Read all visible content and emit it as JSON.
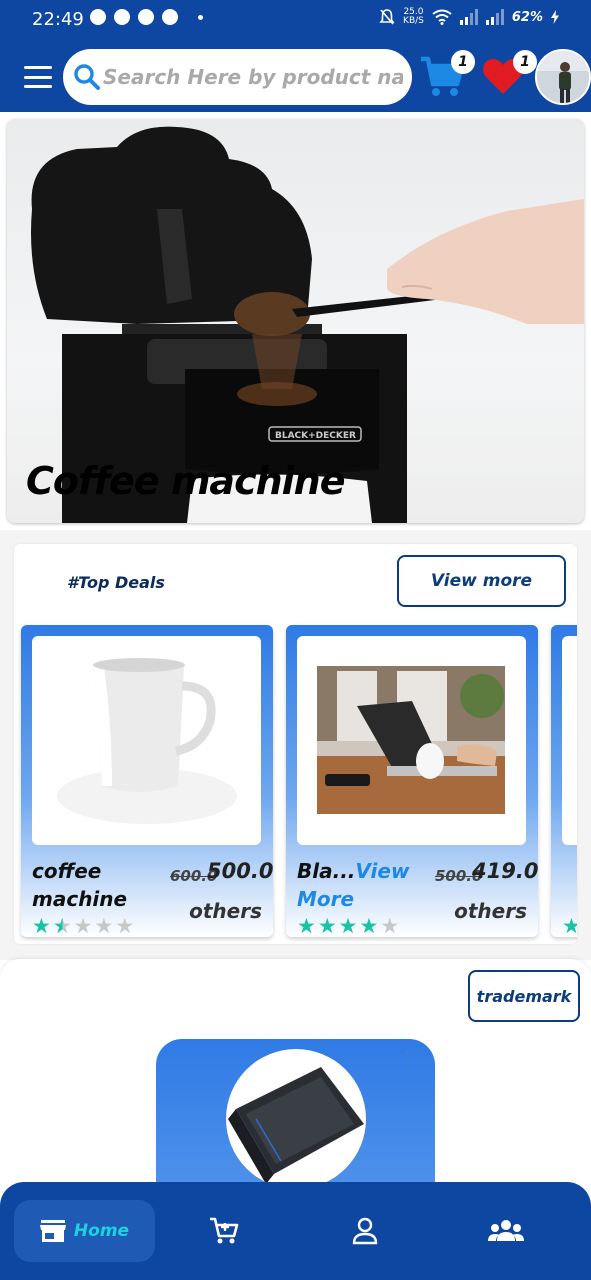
{
  "status_bar": {
    "time": "22:49",
    "speed_value": "25.0",
    "speed_unit": "KB/S",
    "battery": "62%"
  },
  "header": {
    "search_placeholder": "Search Here by product name or",
    "cart_count": "1",
    "wishlist_count": "1",
    "icons": [
      "menu-icon",
      "search-icon",
      "cart-icon",
      "heart-icon",
      "avatar"
    ]
  },
  "banner": {
    "title": "Coffee machine",
    "brand_label": "BLACK+DECKER"
  },
  "top_deals": {
    "title": "#Top Deals",
    "view_more_label": "View more",
    "products": [
      {
        "name": "coffee machine",
        "old_price": "600.0",
        "price": "500.0",
        "seller": "others",
        "rating": 1.5
      },
      {
        "name": "Bla...",
        "view_more": "View More",
        "old_price": "500.0",
        "price": "419.0",
        "seller": "others",
        "rating": 4
      }
    ]
  },
  "trademark": {
    "button_label": "trademark"
  },
  "bottom_nav": {
    "items": [
      {
        "label": "Home",
        "icon": "store-icon",
        "active": true
      },
      {
        "label": "",
        "icon": "cart-icon"
      },
      {
        "label": "",
        "icon": "person-icon"
      },
      {
        "label": "",
        "icon": "group-icon"
      }
    ]
  },
  "colors": {
    "primary": "#0d47a1",
    "accent_blue": "#2f7ae5",
    "cart_icon": "#1e88e5",
    "heart_icon": "#e11b22",
    "star": "#19c4a5",
    "home_label": "#19d3e0"
  }
}
